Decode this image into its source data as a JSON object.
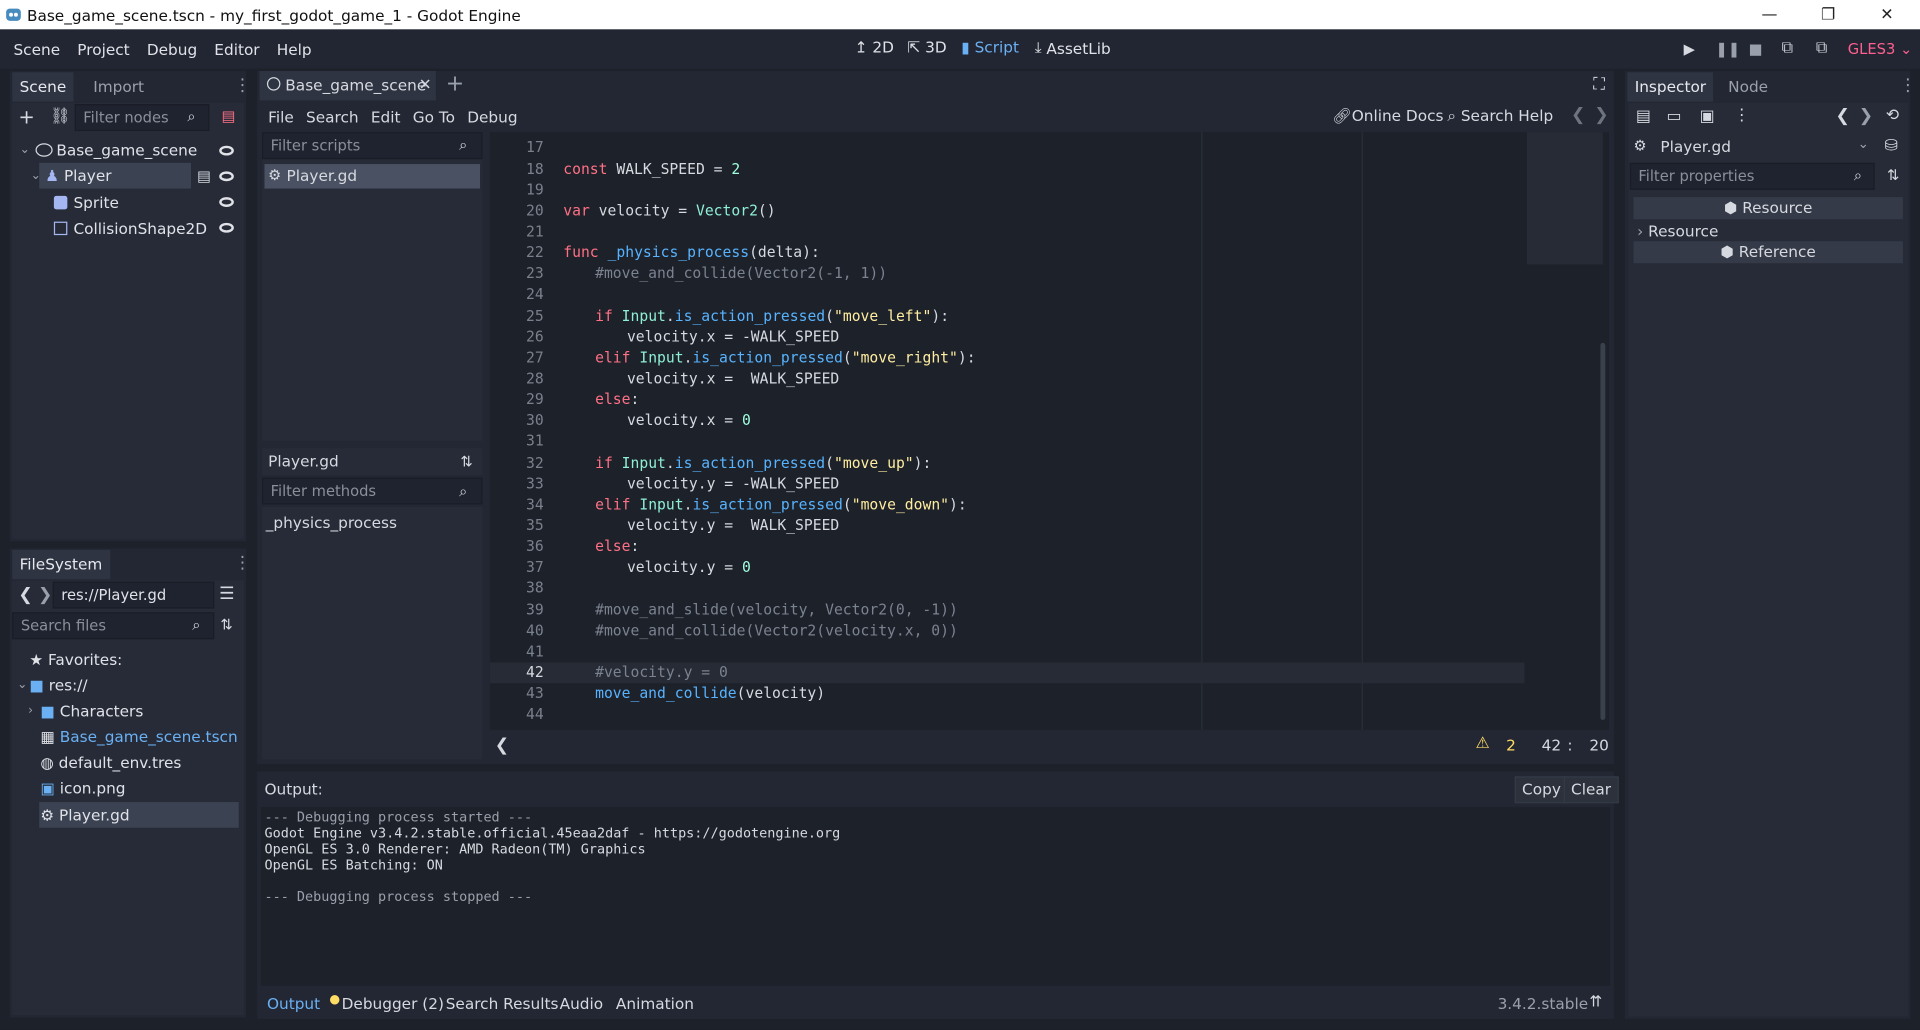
{
  "window": {
    "title": "Base_game_scene.tscn - my_first_godot_game_1 - Godot Engine",
    "min": "—",
    "max": "❐",
    "close": "✕"
  },
  "menu": [
    "Scene",
    "Project",
    "Debug",
    "Editor",
    "Help"
  ],
  "workspaces": {
    "d2": "2D",
    "d3": "3D",
    "script": "Script",
    "assetlib": "AssetLib"
  },
  "renderer": "GLES3",
  "scene_dock": {
    "tabs": [
      "Scene",
      "Import"
    ],
    "filter_placeholder": "Filter nodes",
    "nodes": [
      {
        "label": "Base_game_scene"
      },
      {
        "label": "Player"
      },
      {
        "label": "Sprite"
      },
      {
        "label": "CollisionShape2D"
      }
    ]
  },
  "filesystem": {
    "tab": "FileSystem",
    "path": "res://Player.gd",
    "search_placeholder": "Search files",
    "items": [
      "Favorites:",
      "res://",
      "Characters",
      "Base_game_scene.tscn",
      "default_env.tres",
      "icon.png",
      "Player.gd"
    ]
  },
  "script_editor": {
    "tab": "Base_game_scene",
    "menu": [
      "File",
      "Search",
      "Edit",
      "Go To",
      "Debug"
    ],
    "online_docs": "Online Docs",
    "search_help": "Search Help",
    "filter_scripts": "Filter scripts",
    "script_item": "Player.gd",
    "methods_header": "Player.gd",
    "filter_methods": "Filter methods",
    "method_item": "_physics_process",
    "warnings": "2",
    "line": "42",
    "col": "20",
    "colon": ":"
  },
  "output": {
    "label": "Output:",
    "copy": "Copy",
    "clear": "Clear",
    "lines": [
      "--- Debugging process started ---",
      "Godot Engine v3.4.2.stable.official.45eaa2daf - https://godotengine.org",
      "OpenGL ES 3.0 Renderer: AMD Radeon(TM) Graphics",
      "OpenGL ES Batching: ON",
      "",
      "--- Debugging process stopped ---"
    ]
  },
  "bottom_tabs": {
    "output": "Output",
    "debugger": "Debugger (2)",
    "search": "Search Results",
    "audio": "Audio",
    "animation": "Animation",
    "version": "3.4.2.stable"
  },
  "inspector": {
    "tabs": [
      "Inspector",
      "Node"
    ],
    "object": "Player.gd",
    "filter_placeholder": "Filter properties",
    "sections": [
      "Resource",
      "Resource",
      "Reference"
    ]
  }
}
